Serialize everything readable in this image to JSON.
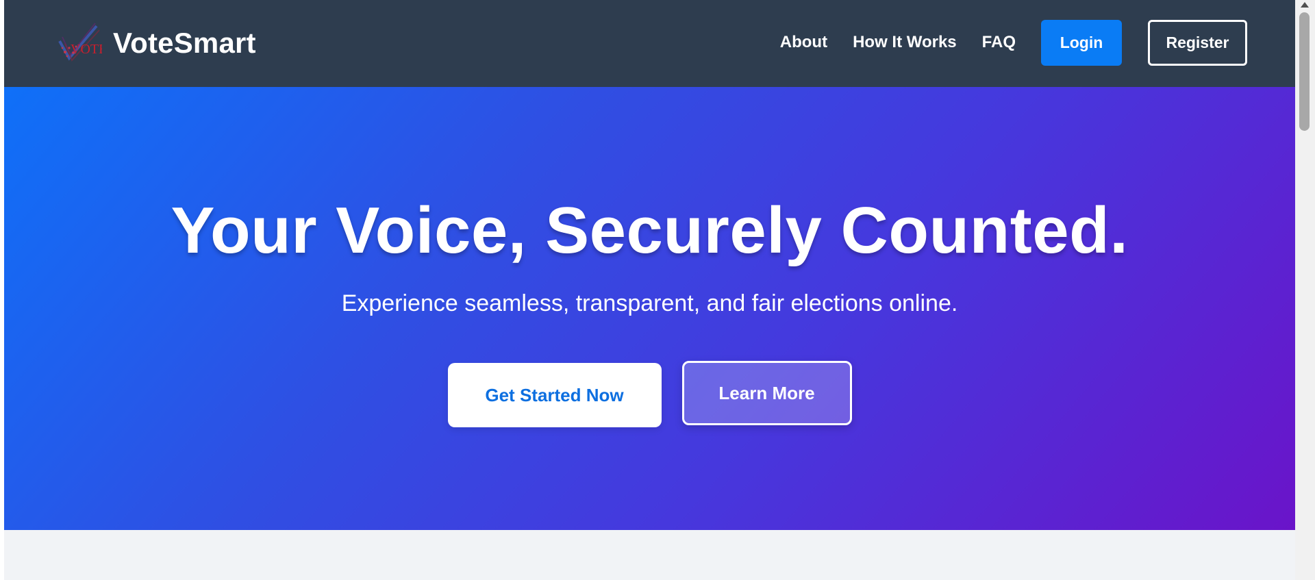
{
  "brand": {
    "name": "VoteSmart",
    "logo_icon": "vote-logo-icon",
    "logo_text": "VOTE"
  },
  "nav": {
    "links": [
      "About",
      "How It Works",
      "FAQ"
    ],
    "login_label": "Login",
    "register_label": "Register"
  },
  "hero": {
    "title": "Your Voice, Securely Counted.",
    "subtitle": "Experience seamless, transparent, and fair elections online.",
    "primary_cta": "Get Started Now",
    "secondary_cta": "Learn More"
  },
  "colors": {
    "header_bg": "#2e3d4f",
    "accent": "#0a7cf5",
    "hero_gradient_start": "#0f70f8",
    "hero_gradient_end": "#6a14c9",
    "page_bg": "#f1f3f6"
  }
}
